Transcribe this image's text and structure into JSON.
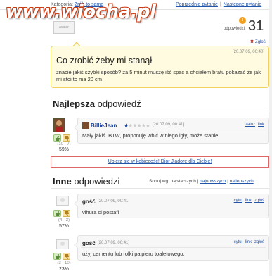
{
  "header": {
    "category_label": "Kategoria:",
    "category_link": "Zrób to sama",
    "prev_question": "Poprzednie pytanie",
    "separator": "|",
    "next_question": "Następne pytanie"
  },
  "watermark": "www.wiocha.pl",
  "asker": {
    "avatar_text": "avatar"
  },
  "answers_count": {
    "label": "odpowiedzi:",
    "value": "31",
    "badge": "!"
  },
  "report": {
    "icon": "x-icon",
    "label": "Zgłoś"
  },
  "question": {
    "date": "[20.07.09, 00:40]",
    "title": "Co zrobić żeby mi stanął",
    "body": "znacie jakiś szybki sposób? za 5 minut muszę iść spać a chciałem bratu pokazać że jak mi stoi to ma 20 cm"
  },
  "best": {
    "heading_bold": "Najlepsza",
    "heading_rest": " odpowiedź",
    "votes": "(10 - 7)",
    "percent": "59%",
    "author": "BillieJean",
    "rating": {
      "on": 1,
      "off": 5
    },
    "date": "[20.07.09, 00:41]",
    "links": [
      "zaloż",
      "link"
    ],
    "text": "Mały jakiś. BTW, proponuję wbić w niego igły, może stanie."
  },
  "ad": {
    "text": "Ubierz się w kobiecość! Dior J'adore dla Ciebie!"
  },
  "others": {
    "heading_bold": "Inne",
    "heading_rest": " odpowiedzi",
    "sort": {
      "prefix": "Sortuj wg: najstarszych",
      "sep": "|",
      "newest": "najnowszych",
      "best": "najlepszych"
    },
    "answers": [
      {
        "author": "gość",
        "date": "[20.07.09, 00:41]",
        "links": [
          "cytuj",
          "link",
          "zgłoś"
        ],
        "text": "vihura ci postafi",
        "votes": "(4 - 3)",
        "percent": "57%"
      },
      {
        "author": "gość",
        "date": "[20.07.09, 00:41]",
        "links": [
          "cytuj",
          "link",
          "zgłoś"
        ],
        "text": "użyj cementu lub rolki paipieru toaletowego.",
        "votes": "(3 - 10)",
        "percent": "23%"
      }
    ]
  },
  "colors": {
    "link": "#2255aa",
    "question_bg": "#fffbe0",
    "question_border": "#f0d060",
    "ad_border": "#dd6666",
    "watermark": "#c83c14"
  }
}
